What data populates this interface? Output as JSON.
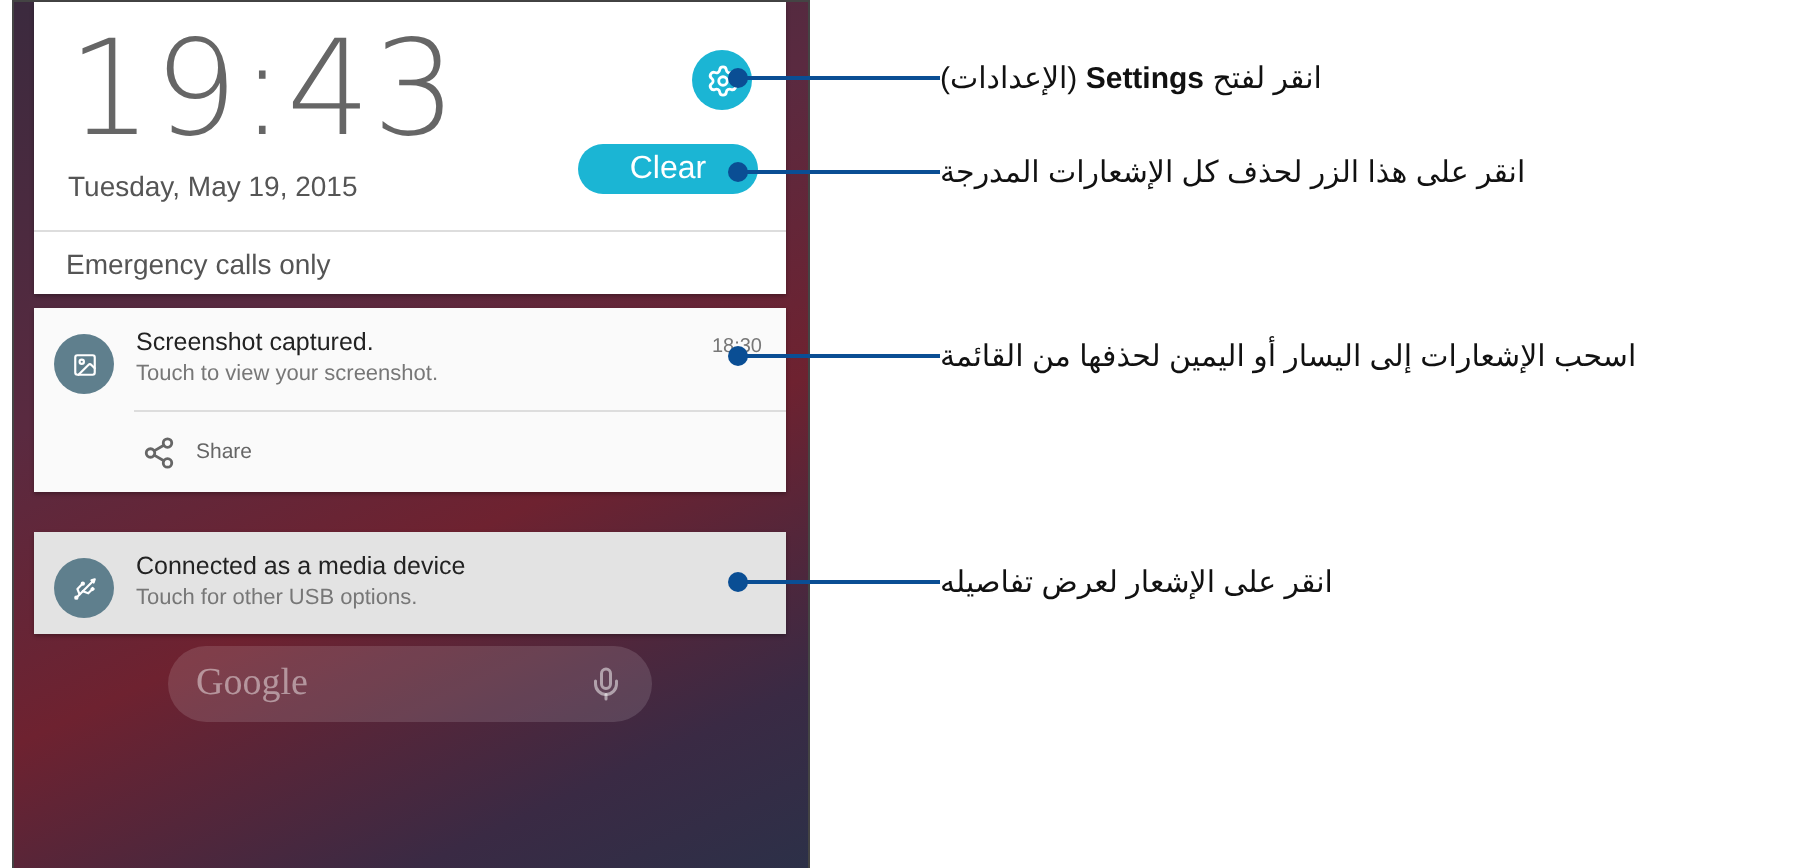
{
  "lock_panel": {
    "time": "19:43",
    "date": "Tuesday, May 19, 2015",
    "clear_button": "Clear",
    "carrier": "Emergency calls only"
  },
  "notifications": [
    {
      "kind": "screenshot",
      "title": "Screenshot captured.",
      "text": "Touch to view your screenshot.",
      "time": "18:30",
      "action": "Share"
    },
    {
      "kind": "usb",
      "title": "Connected as a media device",
      "text": "Touch for other USB options."
    }
  ],
  "search_bar": {
    "placeholder": "Google"
  },
  "callouts": [
    {
      "text": "انقر لفتح **Settings** (الإعدادات)"
    },
    {
      "text": "انقر على هذا الزر لحذف كل الإشعارات المدرجة"
    },
    {
      "text": "اسحب الإشعارات إلى اليسار أو اليمين لحذفها من القائمة"
    },
    {
      "text": "انقر على الإشعار لعرض تفاصيله"
    }
  ]
}
